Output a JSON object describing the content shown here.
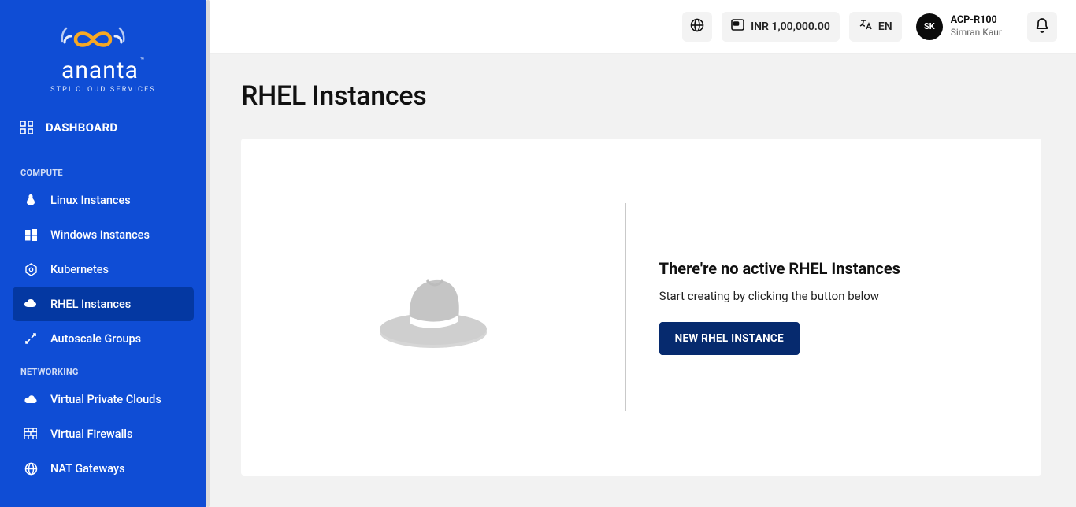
{
  "brand": {
    "name": "ananta",
    "tagline": "STPI CLOUD SERVICES"
  },
  "sidebar": {
    "dashboard": "DASHBOARD",
    "sections": [
      {
        "label": "COMPUTE",
        "items": [
          "Linux Instances",
          "Windows Instances",
          "Kubernetes",
          "RHEL Instances",
          "Autoscale Groups"
        ]
      },
      {
        "label": "NETWORKING",
        "items": [
          "Virtual Private Clouds",
          "Virtual Firewalls",
          "NAT Gateways"
        ]
      }
    ],
    "active": "RHEL Instances"
  },
  "topbar": {
    "balance": "INR 1,00,000.00",
    "lang": "EN",
    "avatar_initials": "SK",
    "account": "ACP-R100",
    "username": "Simran Kaur"
  },
  "page": {
    "title": "RHEL Instances",
    "empty_title": "There're no active RHEL Instances",
    "empty_sub": "Start creating by clicking the button below",
    "cta": "NEW RHEL INSTANCE"
  }
}
